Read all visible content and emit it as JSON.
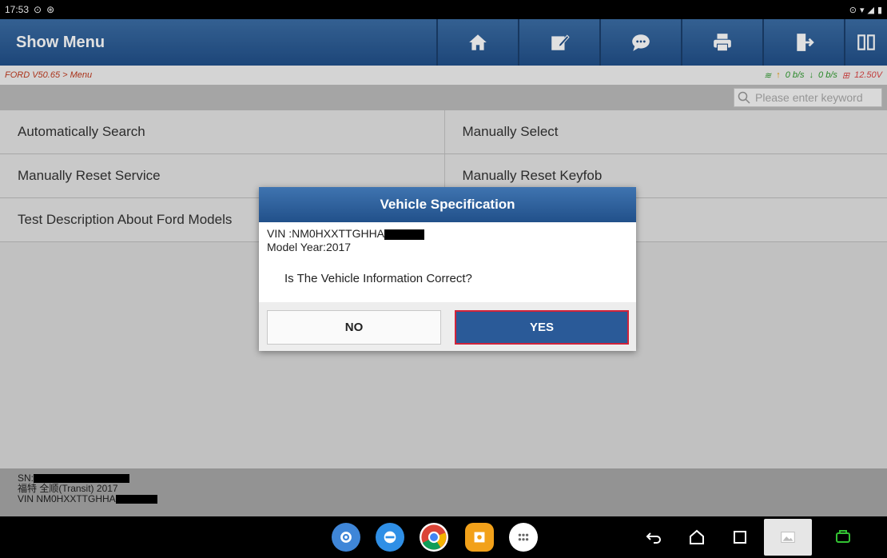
{
  "status_bar": {
    "time": "17:53"
  },
  "app_bar": {
    "title": "Show Menu",
    "toolbar": [
      "home-icon",
      "edit-icon",
      "chat-icon",
      "print-icon",
      "exit-icon",
      "layout-icon"
    ]
  },
  "breadcrumb": {
    "path": "FORD V50.65 > Menu",
    "upload": "0 b/s",
    "download": "0 b/s",
    "voltage": "12.50V"
  },
  "search": {
    "placeholder": "Please enter keyword"
  },
  "menu": {
    "rows": [
      {
        "left": "Automatically Search",
        "right": "Manually Select"
      },
      {
        "left": "Manually Reset Service",
        "right": "Manually Reset Keyfob"
      },
      {
        "left": "Test Description About Ford Models",
        "right": ""
      }
    ]
  },
  "footer": {
    "sn_label": "SN:",
    "vehicle": "福特 全顺(Transit) 2017",
    "vin": "VIN NM0HXXTTGHHA"
  },
  "dialog": {
    "title": "Vehicle Specification",
    "vin": "VIN :NM0HXXTTGHHA",
    "model_year": "Model Year:2017",
    "question": "Is The Vehicle Information Correct?",
    "no_label": "NO",
    "yes_label": "YES"
  },
  "colors": {
    "accent": "#21508a",
    "highlight": "#d0233a"
  }
}
